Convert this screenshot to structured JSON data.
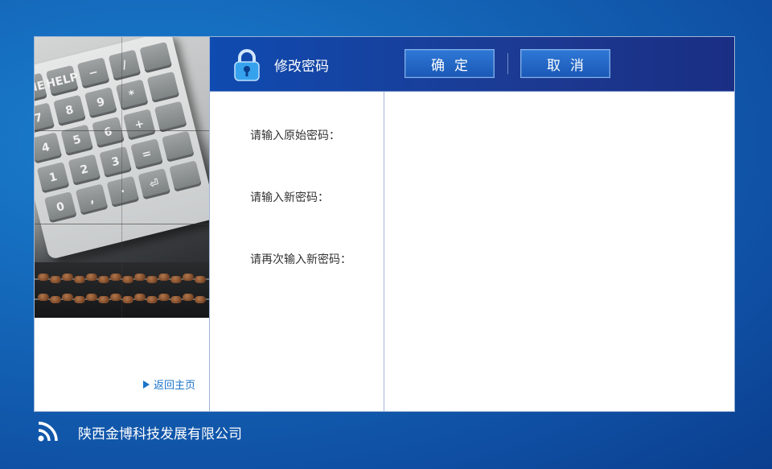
{
  "header": {
    "title": "修改密码",
    "confirm_label": "确定",
    "cancel_label": "取消"
  },
  "form": {
    "labels": [
      "请输入原始密码：",
      "请输入新密码：",
      "请再次输入新密码："
    ]
  },
  "sidebar": {
    "home_link": "返回主页",
    "keypad_keys": [
      "OME",
      "HELP",
      "−",
      "/",
      "",
      "7",
      "8",
      "9",
      "*",
      "",
      "4",
      "5",
      "6",
      "+",
      "",
      "1",
      "2",
      "3",
      "=",
      "",
      "0",
      ",",
      "·",
      "⏎",
      ""
    ]
  },
  "footer": {
    "company": "陕西金博科技发展有限公司"
  },
  "colors": {
    "accent": "#1a73c8",
    "header_bg": "#0f4bb0",
    "page_bg": "#1466b8"
  },
  "icons": {
    "lock": "lock-icon",
    "rss": "rss-icon",
    "arrow": "arrow-right-icon"
  }
}
